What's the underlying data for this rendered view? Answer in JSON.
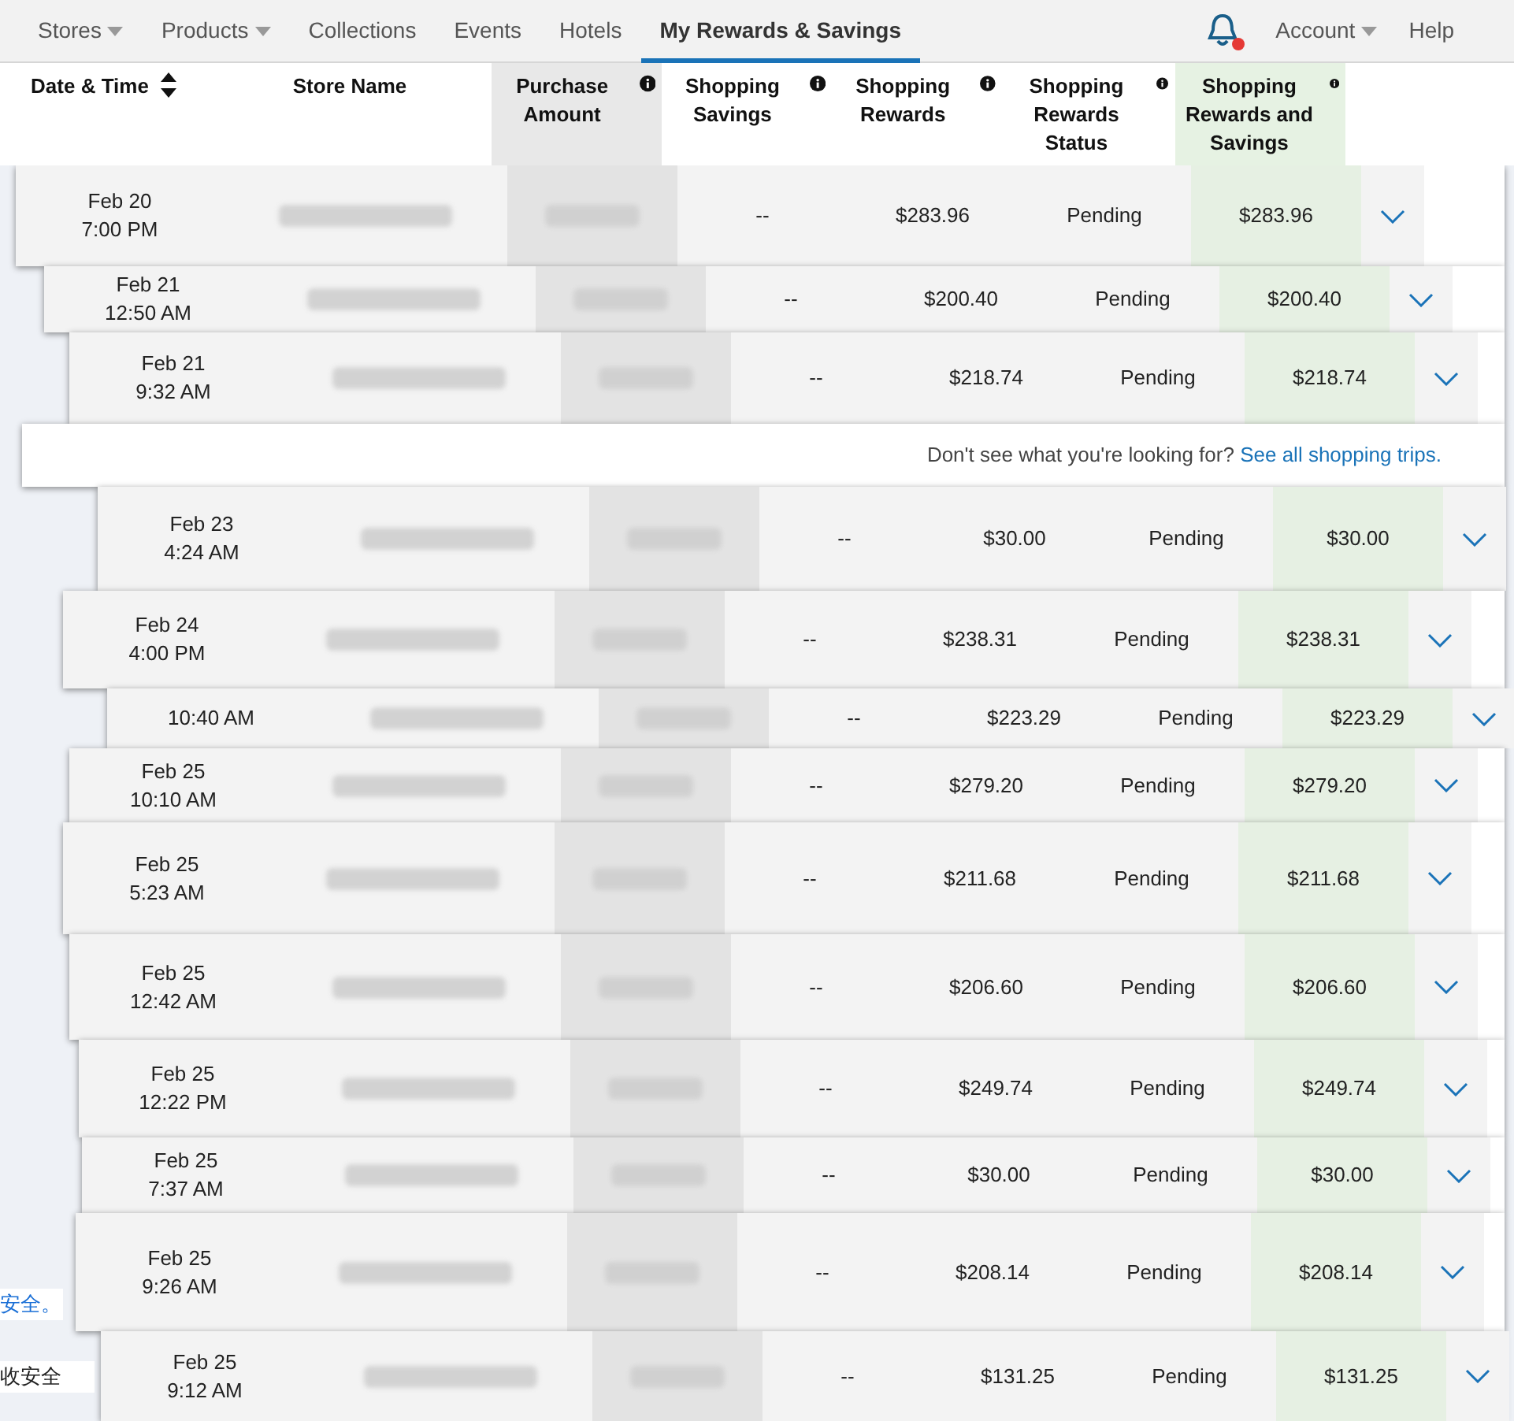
{
  "nav": {
    "items": [
      {
        "label": "Stores",
        "dropdown": true,
        "selected": false
      },
      {
        "label": "Products",
        "dropdown": true,
        "selected": false
      },
      {
        "label": "Collections",
        "dropdown": false,
        "selected": false
      },
      {
        "label": "Events",
        "dropdown": false,
        "selected": false
      },
      {
        "label": "Hotels",
        "dropdown": false,
        "selected": false
      },
      {
        "label": "My Rewards & Savings",
        "dropdown": false,
        "selected": true
      }
    ],
    "notification": {
      "unread": true
    },
    "account": "Account",
    "help": "Help"
  },
  "columns": [
    {
      "label": "Date & Time",
      "kind": "sortable"
    },
    {
      "label": "Store Name",
      "kind": "plain"
    },
    {
      "label": "Purchase Amount",
      "kind": "info"
    },
    {
      "label": "Shopping Savings",
      "kind": "info"
    },
    {
      "label": "Shopping Rewards",
      "kind": "info"
    },
    {
      "label": "Shopping Rewards Status",
      "kind": "info"
    },
    {
      "label": "Shopping Rewards and Savings",
      "kind": "info"
    }
  ],
  "rows": [
    {
      "kind": "trip",
      "date": "Feb 20",
      "time": "7:00 PM",
      "savings": "--",
      "rewards": "$283.96",
      "status": "Pending",
      "total": "$283.96"
    },
    {
      "kind": "trip",
      "date": "Feb 21",
      "time": "12:50 AM",
      "savings": "--",
      "rewards": "$200.40",
      "status": "Pending",
      "total": "$200.40"
    },
    {
      "kind": "trip",
      "date": "Feb 21",
      "time": "9:32 AM",
      "savings": "--",
      "rewards": "$218.74",
      "status": "Pending",
      "total": "$218.74"
    },
    {
      "kind": "note",
      "text": "Don't see what you're looking for?",
      "link": "See all shopping trips."
    },
    {
      "kind": "trip",
      "date": "Feb 23",
      "time": "4:24 AM",
      "savings": "--",
      "rewards": "$30.00",
      "status": "Pending",
      "total": "$30.00"
    },
    {
      "kind": "trip",
      "date": "Feb 24",
      "time": "4:00 PM",
      "savings": "--",
      "rewards": "$238.31",
      "status": "Pending",
      "total": "$238.31"
    },
    {
      "kind": "trip",
      "time": "10:40 AM",
      "savings": "--",
      "rewards": "$223.29",
      "status": "Pending",
      "total": "$223.29"
    },
    {
      "kind": "trip",
      "date": "Feb 25",
      "time": "10:10 AM",
      "savings": "--",
      "rewards": "$279.20",
      "status": "Pending",
      "total": "$279.20"
    },
    {
      "kind": "trip",
      "date": "Feb 25",
      "time": "5:23 AM",
      "savings": "--",
      "rewards": "$211.68",
      "status": "Pending",
      "total": "$211.68"
    },
    {
      "kind": "trip",
      "date": "Feb 25",
      "time": "12:42 AM",
      "savings": "--",
      "rewards": "$206.60",
      "status": "Pending",
      "total": "$206.60"
    },
    {
      "kind": "trip",
      "date": "Feb 25",
      "time": "12:22 PM",
      "savings": "--",
      "rewards": "$249.74",
      "status": "Pending",
      "total": "$249.74"
    },
    {
      "kind": "trip",
      "date": "Feb 25",
      "time": "7:37 AM",
      "savings": "--",
      "rewards": "$30.00",
      "status": "Pending",
      "total": "$30.00"
    },
    {
      "kind": "trip",
      "date": "Feb 25",
      "time": "9:26 AM",
      "savings": "--",
      "rewards": "$208.14",
      "status": "Pending",
      "total": "$208.14"
    },
    {
      "kind": "trip",
      "date": "Feb 25",
      "time": "9:12 AM",
      "savings": "--",
      "rewards": "$131.25",
      "status": "Pending",
      "total": "$131.25"
    }
  ],
  "background_texts": [
    "安全。",
    "收安全"
  ]
}
